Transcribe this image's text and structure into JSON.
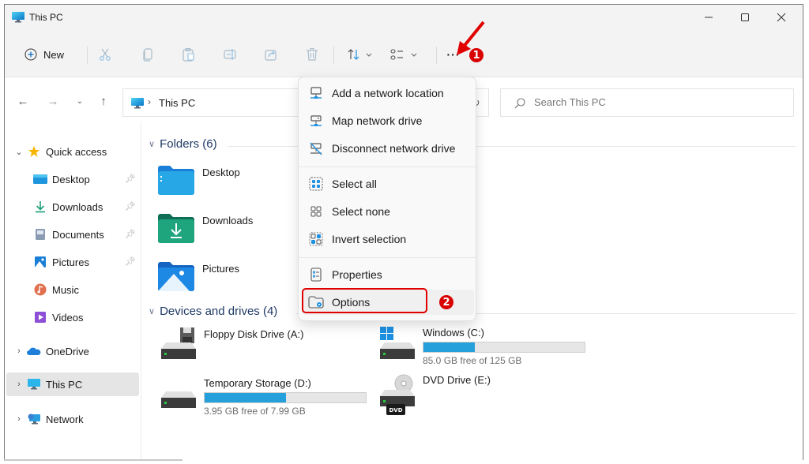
{
  "window": {
    "title": "This PC",
    "controls": {
      "minimize": "minimize",
      "maximize": "maximize",
      "close": "close"
    }
  },
  "toolbar": {
    "new_label": "New",
    "buttons": [
      "cut",
      "copy",
      "paste",
      "rename",
      "share",
      "delete",
      "sort",
      "view",
      "see-more"
    ],
    "more_label": "···"
  },
  "nav": {
    "breadcrumb": [
      "This PC"
    ],
    "search_placeholder": "Search This PC"
  },
  "sidebar": {
    "items": [
      {
        "label": "Quick access",
        "icon": "star-icon",
        "expanded": true
      },
      {
        "label": "Desktop",
        "icon": "desktop-folder-icon",
        "pinned": true
      },
      {
        "label": "Downloads",
        "icon": "download-icon",
        "pinned": true
      },
      {
        "label": "Documents",
        "icon": "documents-icon",
        "pinned": true
      },
      {
        "label": "Pictures",
        "icon": "pictures-icon",
        "pinned": true
      },
      {
        "label": "Music",
        "icon": "music-icon"
      },
      {
        "label": "Videos",
        "icon": "videos-icon"
      },
      {
        "label": "OneDrive",
        "icon": "cloud-icon",
        "expanded": false
      },
      {
        "label": "This PC",
        "icon": "pc-icon",
        "expanded": false,
        "selected": true
      },
      {
        "label": "Network",
        "icon": "network-icon",
        "expanded": false
      }
    ]
  },
  "content": {
    "folders_header": "Folders (6)",
    "folders": [
      {
        "name": "Desktop"
      },
      {
        "name": "Downloads"
      },
      {
        "name": "Pictures"
      }
    ],
    "drives_header": "Devices and drives (4)",
    "drives": [
      {
        "name": "Floppy Disk Drive (A:)"
      },
      {
        "name": "Windows (C:)",
        "free_text": "85.0 GB free of 125 GB",
        "used_fraction": 0.32
      },
      {
        "name": "Temporary Storage (D:)",
        "free_text": "3.95 GB free of 7.99 GB",
        "used_fraction": 0.506
      },
      {
        "name": "DVD Drive (E:)",
        "badge": "DVD"
      }
    ]
  },
  "menu": {
    "items": [
      {
        "label": "Add a network location",
        "icon": "network-location-icon"
      },
      {
        "label": "Map network drive",
        "icon": "map-drive-icon"
      },
      {
        "label": "Disconnect network drive",
        "icon": "disconnect-drive-icon"
      },
      {
        "label": "Select all",
        "icon": "select-all-icon"
      },
      {
        "label": "Select none",
        "icon": "select-none-icon"
      },
      {
        "label": "Invert selection",
        "icon": "invert-selection-icon"
      },
      {
        "label": "Properties",
        "icon": "properties-icon"
      },
      {
        "label": "Options",
        "icon": "options-icon",
        "highlighted": true
      }
    ]
  },
  "annotations": {
    "step1": "1",
    "step2": "2",
    "color": "#d90000"
  }
}
